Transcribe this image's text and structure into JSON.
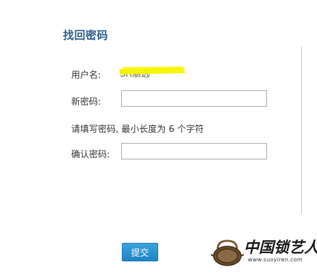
{
  "form": {
    "title": "找回密码",
    "username_label": "用户名:",
    "username_value": "SH崩选",
    "new_password_label": "新密码:",
    "new_password_value": "",
    "password_hint": "请填写密码, 最小长度为 6 个字符",
    "confirm_password_label": "确认密码:",
    "confirm_password_value": "",
    "submit_label": "提交"
  },
  "watermark": {
    "text": "中国锁艺人",
    "url": "www.suoyiren.com",
    "logo_text": "锁艺人"
  },
  "colors": {
    "title": "#2c5d8e",
    "highlight": "#f5f500",
    "button": "#2a93d2"
  }
}
